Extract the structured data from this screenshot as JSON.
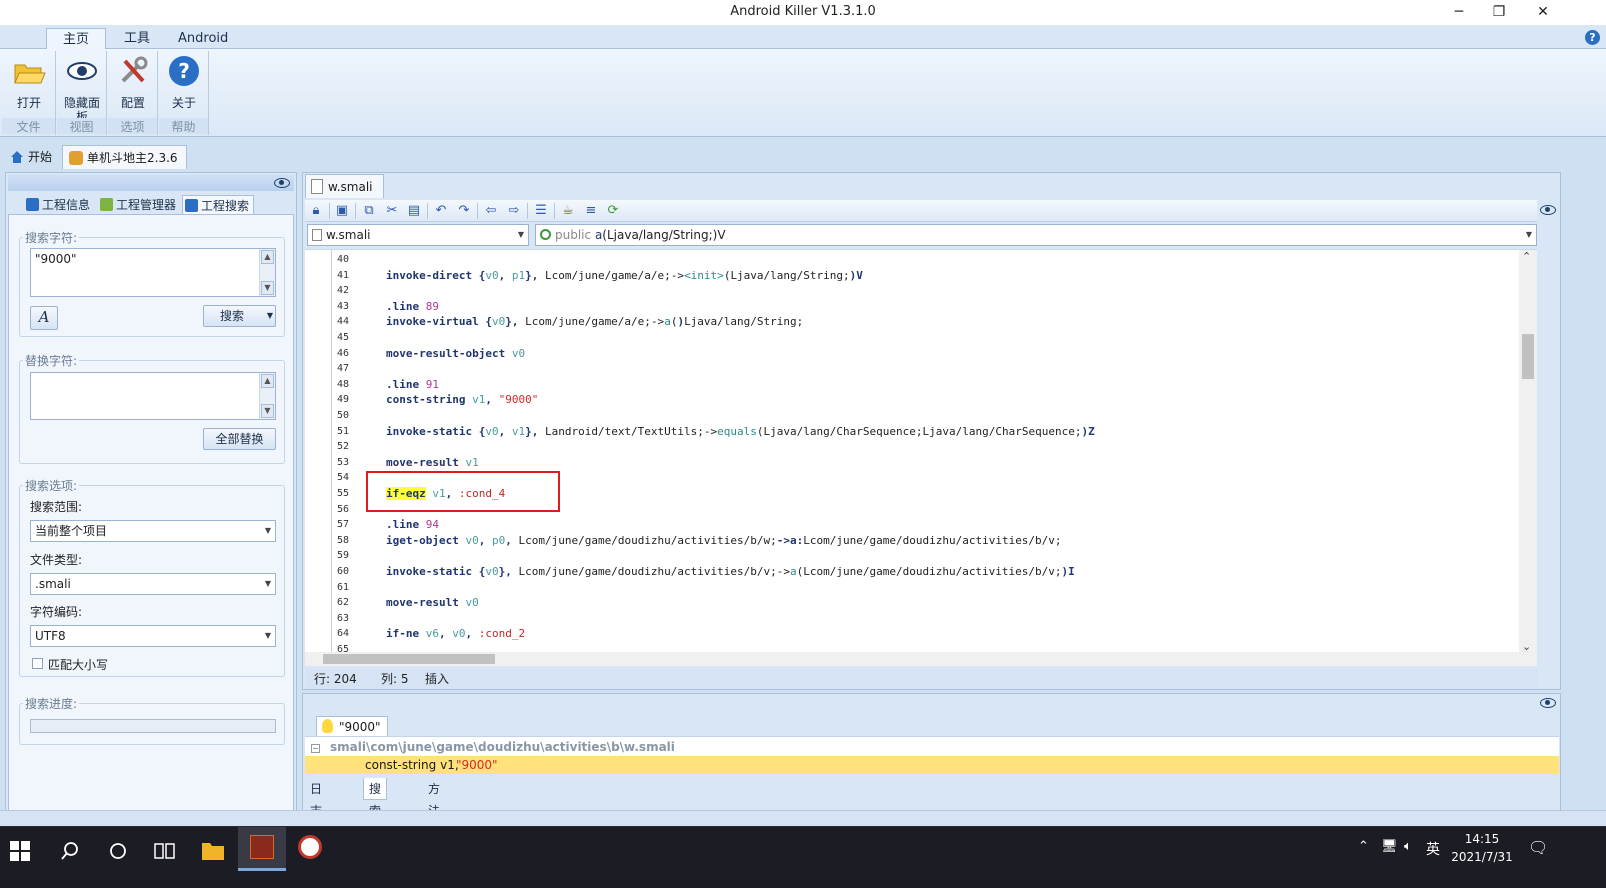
{
  "window": {
    "title": "Android Killer V1.3.1.0",
    "minimize": "─",
    "maximize": "❐",
    "close": "✕"
  },
  "ribbon": {
    "tabs": [
      "主页",
      "工具",
      "Android"
    ],
    "help": "?",
    "groups": [
      {
        "name": "文件",
        "buttons": [
          {
            "label": "打开",
            "icon": "open-folder-icon"
          }
        ]
      },
      {
        "name": "视图",
        "buttons": [
          {
            "label": "隐藏面板",
            "icon": "eye-icon"
          }
        ]
      },
      {
        "name": "选项",
        "buttons": [
          {
            "label": "配置",
            "icon": "tools-icon"
          }
        ]
      },
      {
        "name": "帮助",
        "buttons": [
          {
            "label": "关于",
            "icon": "help-icon"
          }
        ]
      }
    ]
  },
  "doc_tabs": {
    "home": "开始",
    "project": "单机斗地主2.3.6"
  },
  "left_panel": {
    "subtabs": [
      "工程信息",
      "工程管理器",
      "工程搜索"
    ],
    "search_label": "搜索字符:",
    "search_value": "\"9000\"",
    "search_button": "搜索",
    "case_icon_label": "A",
    "replace_label": "替换字符:",
    "replace_value": "",
    "replace_all_button": "全部替换",
    "options_label": "搜索选项:",
    "scope_label": "搜索范围:",
    "scope_value": "当前整个项目",
    "filetype_label": "文件类型:",
    "filetype_value": ".smali",
    "encoding_label": "字符编码:",
    "encoding_value": "UTF8",
    "match_case_label": "匹配大小写",
    "progress_label": "搜索进度:",
    "progress": 0
  },
  "editor": {
    "file_tab": "w.smali",
    "file_combo": "w.smali",
    "method_combo_modifier": "public",
    "method_combo_name": "a",
    "method_combo_sig": "(Ljava/lang/String;)V",
    "lines": [
      {
        "n": "40",
        "t": ""
      },
      {
        "n": "41",
        "t": "invoke-direct {v0, p1}, Lcom/june/game/a/e;-><init>(Ljava/lang/String;)V"
      },
      {
        "n": "42",
        "t": ""
      },
      {
        "n": "43",
        "t": ".line 89"
      },
      {
        "n": "44",
        "t": "invoke-virtual {v0}, Lcom/june/game/a/e;->a()Ljava/lang/String;"
      },
      {
        "n": "45",
        "t": ""
      },
      {
        "n": "46",
        "t": "move-result-object v0"
      },
      {
        "n": "47",
        "t": ""
      },
      {
        "n": "48",
        "t": ".line 91"
      },
      {
        "n": "49",
        "t": "const-string v1, \"9000\""
      },
      {
        "n": "50",
        "t": ""
      },
      {
        "n": "51",
        "t": "invoke-static {v0, v1}, Landroid/text/TextUtils;->equals(Ljava/lang/CharSequence;Ljava/lang/CharSequence;)Z"
      },
      {
        "n": "52",
        "t": ""
      },
      {
        "n": "53",
        "t": "move-result v1"
      },
      {
        "n": "54",
        "t": ""
      },
      {
        "n": "55",
        "t": "if-eqz v1, :cond_4"
      },
      {
        "n": "56",
        "t": ""
      },
      {
        "n": "57",
        "t": ".line 94"
      },
      {
        "n": "58",
        "t": "iget-object v0, p0, Lcom/june/game/doudizhu/activities/b/w;->a:Lcom/june/game/doudizhu/activities/b/v;"
      },
      {
        "n": "59",
        "t": ""
      },
      {
        "n": "60",
        "t": "invoke-static {v0}, Lcom/june/game/doudizhu/activities/b/v;->a(Lcom/june/game/doudizhu/activities/b/v;)I"
      },
      {
        "n": "61",
        "t": ""
      },
      {
        "n": "62",
        "t": "move-result v0"
      },
      {
        "n": "63",
        "t": ""
      },
      {
        "n": "64",
        "t": "if-ne v6, v0, :cond_2"
      },
      {
        "n": "65",
        "t": ""
      }
    ],
    "status_row_label": "行: 204",
    "status_col_label": "列: 5",
    "status_mode": "插入"
  },
  "results": {
    "tab": "\"9000\"",
    "path": "smali\\com\\june\\game\\doudizhu\\activities\\b\\w.smali",
    "match_prefix": "const-string v1, ",
    "match_value": "\"9000\"",
    "bottom_tabs": [
      "日志输出",
      "搜索结果",
      "方法引用"
    ]
  },
  "taskbar": {
    "time": "14:15",
    "date": "2021/7/31",
    "ime": "英"
  },
  "colors": {
    "highlight": "#ffff3a",
    "redbox": "#e01b1b",
    "result_row": "#ffe27a"
  }
}
